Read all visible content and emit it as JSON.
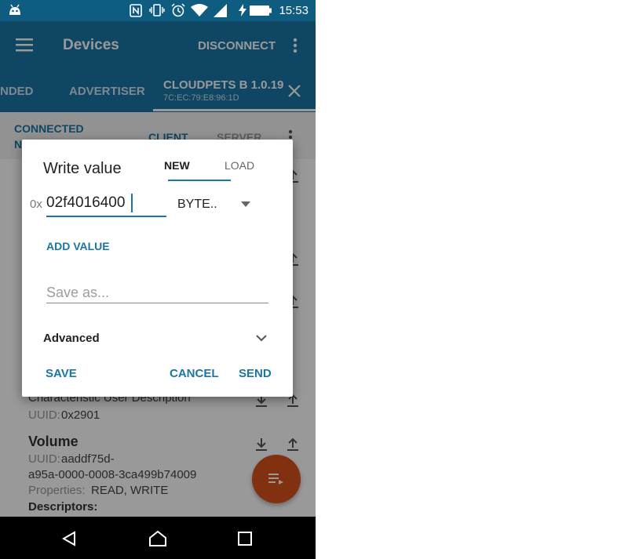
{
  "status_bar": {
    "time": "15:53"
  },
  "toolbar": {
    "title": "Devices",
    "disconnect_label": "DISCONNECT"
  },
  "tabs": {
    "left_partial": "NDED",
    "advertiser": "ADVERTISER",
    "active_name": "CLOUDPETS B 1.0.19",
    "active_address": "7C:EC:79:E8:96:1D"
  },
  "subheader": {
    "status_line1": "CONNECTED",
    "status_line2": "N",
    "client": "CLIENT",
    "server": "SERVER"
  },
  "content": {
    "descriptor_title": "Characteristic User Description",
    "descriptor_uuid_label": "UUID:",
    "descriptor_uuid": "0x2901",
    "char_title": "Volume",
    "char_uuid_label": "UUID:",
    "char_uuid_line1": "aaddf75d-",
    "char_uuid_line2": "a95a-0000-0008-3ca499b74009",
    "properties_label": "Properties:",
    "properties_value": "READ, WRITE",
    "descriptors_label": "Descriptors:"
  },
  "dialog": {
    "title": "Write value",
    "tab_new": "NEW",
    "tab_load": "LOAD",
    "hex_prefix": "0x",
    "hex_value": "02f4016400",
    "type_selected": "BYTE..",
    "add_value": "ADD VALUE",
    "save_as_placeholder": "Save as...",
    "advanced": "Advanced",
    "save": "SAVE",
    "cancel": "CANCEL",
    "send": "SEND"
  },
  "colors": {
    "primary": "#1976a5",
    "primary_dark": "#0e5c80",
    "accent": "#d9531c"
  }
}
